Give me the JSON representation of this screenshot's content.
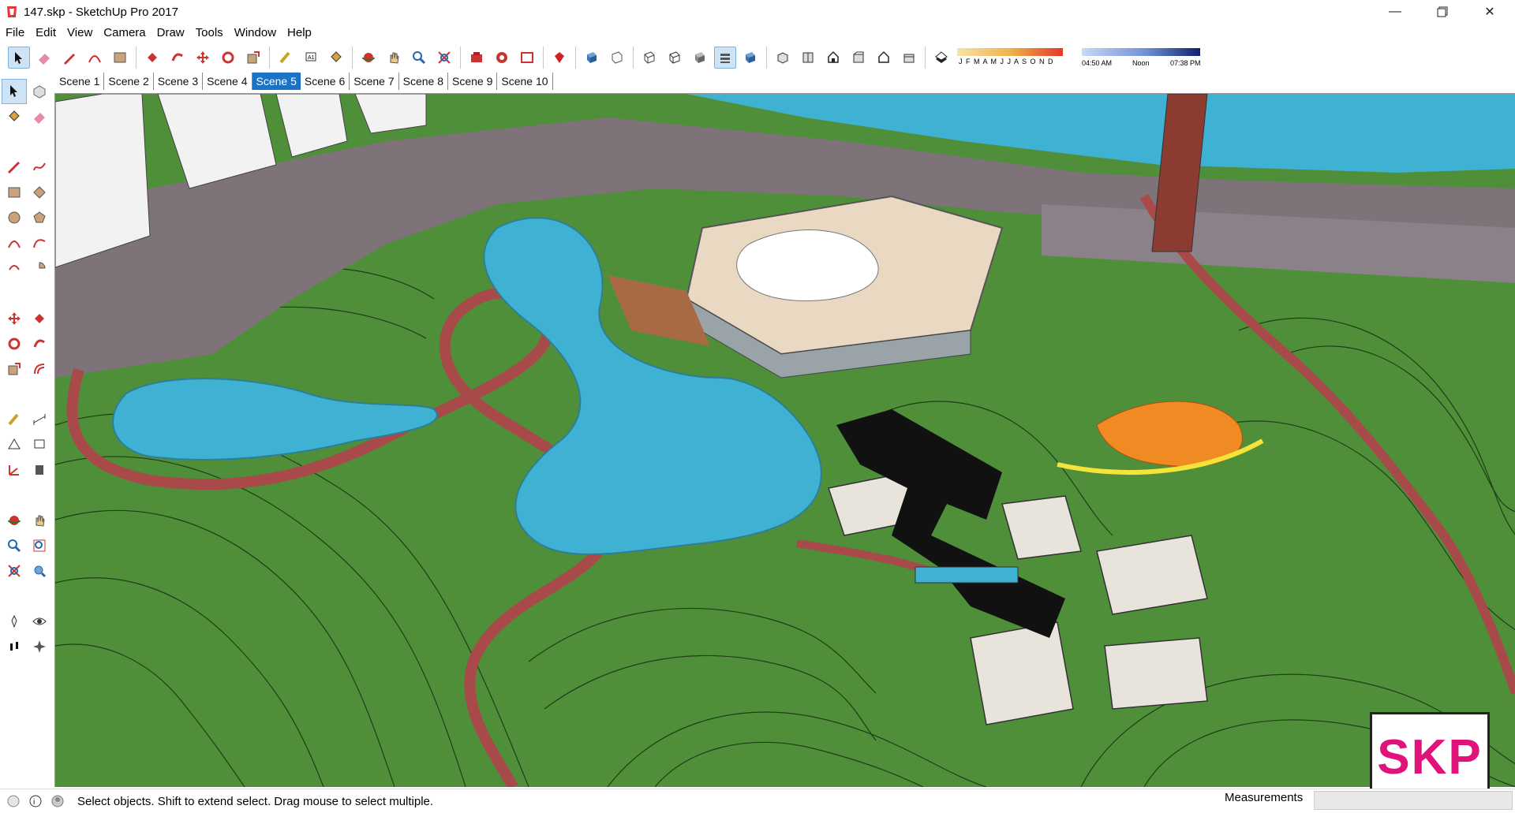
{
  "window": {
    "title": "147.skp - SketchUp Pro 2017"
  },
  "menu": [
    "File",
    "Edit",
    "View",
    "Camera",
    "Draw",
    "Tools",
    "Window",
    "Help"
  ],
  "scenes": {
    "items": [
      "Scene 1",
      "Scene 2",
      "Scene 3",
      "Scene 4",
      "Scene 5",
      "Scene 6",
      "Scene 7",
      "Scene 8",
      "Scene 9",
      "Scene 10"
    ],
    "active_index": 4
  },
  "shadow": {
    "months": "J F M A M J J A S O N D",
    "time_start": "04:50 AM",
    "time_mid": "Noon",
    "time_end": "07:38 PM"
  },
  "status": {
    "hint": "Select objects. Shift to extend select. Drag mouse to select multiple.",
    "measurements_label": "Measurements",
    "measurements_value": ""
  },
  "watermark": {
    "text": "SKP"
  },
  "colors": {
    "grass": "#4f8f3a",
    "path": "#a94a4a",
    "water": "#3fb2d4",
    "road": "#7d7378",
    "accent": "#1a73c7",
    "brand": "#e0137b"
  },
  "toolbar_icons": [
    "select-icon",
    "eraser-icon",
    "pencil-icon",
    "arc-icon",
    "rectangle-icon",
    "push-pull-icon",
    "follow-me-icon",
    "move-icon",
    "rotate-icon",
    "scale-icon",
    "tape-measure-icon",
    "text-icon",
    "paint-bucket-icon",
    "orbit-icon",
    "pan-icon",
    "zoom-icon",
    "zoom-extents-icon",
    "warehouse-icon",
    "extension-warehouse-icon",
    "layout-icon",
    "ruby-icon",
    "xray-icon",
    "back-edges-icon",
    "wireframe-icon",
    "hidden-line-icon",
    "shaded-icon",
    "shaded-texture-icon",
    "monochrome-icon",
    "iso-view-icon",
    "top-view-icon",
    "front-view-icon",
    "right-view-icon",
    "back-view-icon",
    "left-view-icon",
    "shadows-icon"
  ],
  "left_tools": [
    "select-icon",
    "component-icon",
    "paint-bucket-icon",
    "eraser-icon",
    "line-icon",
    "freehand-icon",
    "rectangle-icon",
    "rotated-rectangle-icon",
    "circle-icon",
    "polygon-icon",
    "arc-icon",
    "two-point-arc-icon",
    "three-point-arc-icon",
    "pie-icon",
    "move-icon",
    "push-pull-icon",
    "rotate-icon",
    "follow-me-icon",
    "scale-icon",
    "offset-icon",
    "tape-measure-icon",
    "dimension-icon",
    "protractor-icon",
    "text-icon",
    "axes-icon",
    "3d-text-icon",
    "orbit-icon",
    "pan-icon",
    "zoom-icon",
    "zoom-window-icon",
    "zoom-extents-icon",
    "previous-view-icon",
    "position-camera-icon",
    "look-around-icon",
    "walk-icon",
    "section-plane-icon"
  ]
}
